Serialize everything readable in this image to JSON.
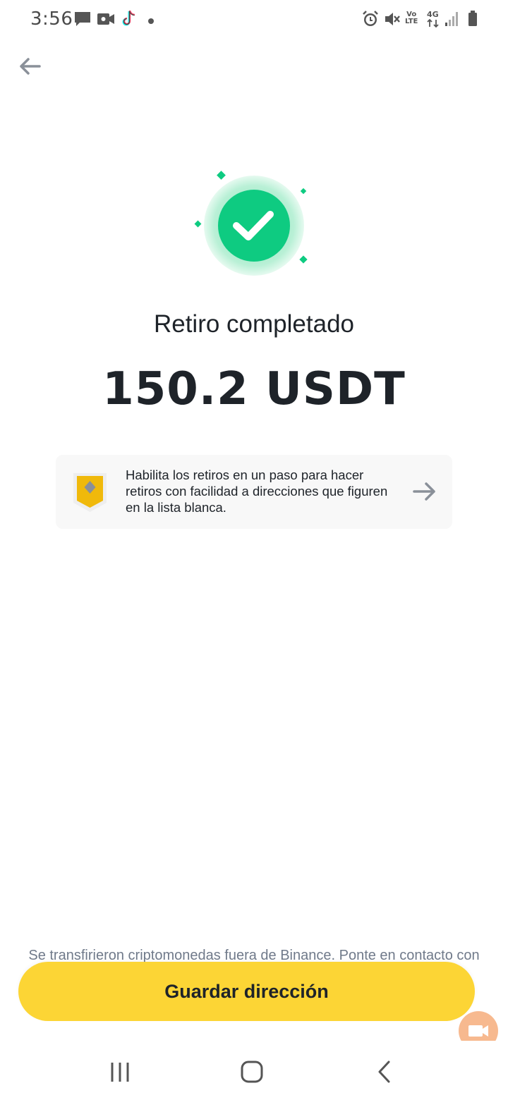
{
  "status_bar": {
    "time": "3:56",
    "left_icons": [
      "message-icon",
      "video-icon",
      "tiktok-icon",
      "dot-icon"
    ],
    "right_icons": [
      "alarm-icon",
      "mute-icon",
      "volte-icon",
      "network-4g-icon",
      "signal-icon",
      "battery-icon"
    ],
    "volte_label": "Vo\nLTE",
    "network_label": "4G"
  },
  "header": {
    "back_icon": "arrow-left-icon"
  },
  "result": {
    "icon": "check-circle-icon",
    "title": "Retiro completado",
    "amount": "150.2 USDT",
    "accent_color": "#0ecb81"
  },
  "banner": {
    "icon": "shield-icon",
    "text": "Habilita los retiros en un paso para hacer retiros con facilidad a direcciones que figuren en la lista blanca.",
    "arrow_icon": "arrow-right-icon"
  },
  "footer": {
    "note": "Se transfirieron criptomonedas fuera de Binance. Ponte en contacto con el destinatario para obtener más información.",
    "save_button": "Guardar dirección",
    "brand_color": "#fcd535"
  },
  "nav": {
    "recent_icon": "recent-apps-icon",
    "home_icon": "home-icon",
    "back_icon": "back-chevron-icon"
  }
}
